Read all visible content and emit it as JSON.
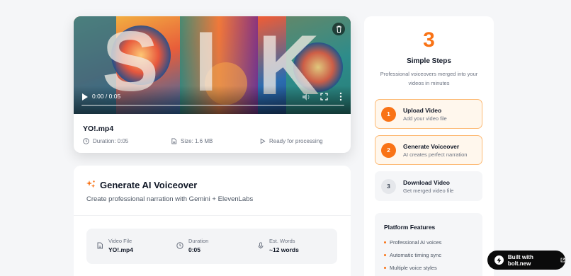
{
  "video": {
    "time": "0:00 / 0:05",
    "file_name": "YO!.mp4",
    "duration": "Duration: 0:05",
    "size": "Size: 1.6 MB",
    "status": "Ready for processing"
  },
  "generate": {
    "title": "Generate AI Voiceover",
    "subtitle": "Create professional narration with Gemini + ElevenLabs",
    "info": [
      {
        "label": "Video File",
        "value": "YO!.mp4"
      },
      {
        "label": "Duration",
        "value": "0:05"
      },
      {
        "label": "Est. Words",
        "value": "~12 words"
      }
    ]
  },
  "steps_panel": {
    "big_number": "3",
    "title": "Simple Steps",
    "description": "Professional voiceovers merged into your videos in minutes",
    "steps": [
      {
        "num": "1",
        "title": "Upload Video",
        "subtitle": "Add your video file"
      },
      {
        "num": "2",
        "title": "Generate Voiceover",
        "subtitle": "AI creates perfect narration"
      },
      {
        "num": "3",
        "title": "Download Video",
        "subtitle": "Get merged video file"
      }
    ],
    "features_title": "Platform Features",
    "features": [
      "Professional AI voices",
      "Automatic timing sync",
      "Multiple voice styles"
    ]
  },
  "badge": {
    "label": "Built with bolt.new"
  },
  "colors": {
    "accent": "#f97316",
    "accent_light": "#fff7ed",
    "badge_bg": "#0b0b0b"
  },
  "icons": {
    "delete": "trash-icon",
    "play": "play-icon",
    "volume": "volume-icon",
    "fullscreen": "fullscreen-icon",
    "more": "more-vertical-icon",
    "clock": "clock-icon",
    "file": "file-icon",
    "status": "play-outline-icon",
    "sparkle": "sparkle-icon",
    "mic": "mic-icon",
    "bolt": "bolt-icon",
    "external": "external-link-icon"
  }
}
